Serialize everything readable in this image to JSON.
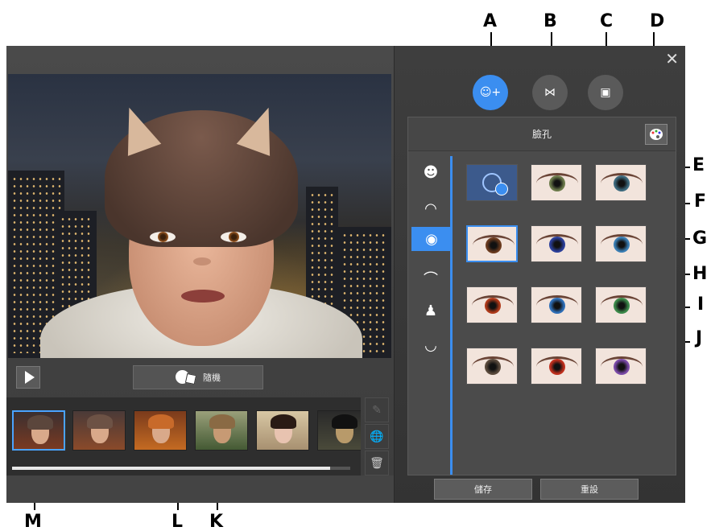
{
  "callouts": [
    "A",
    "B",
    "C",
    "D",
    "E",
    "F",
    "G",
    "H",
    "I",
    "J",
    "K",
    "L",
    "M"
  ],
  "window": {
    "close_glyph": "✕"
  },
  "preview": {
    "background": "night-city-scene"
  },
  "controls": {
    "play_icon": "play-icon",
    "random_label": "隨機"
  },
  "filmstrip": {
    "thumbnails": [
      "thumb-1",
      "thumb-2",
      "thumb-3",
      "thumb-4",
      "thumb-5",
      "thumb-6"
    ],
    "selected_index": 0,
    "scroll_fraction": 0.94
  },
  "side_tools": [
    {
      "icon": "edit-icon"
    },
    {
      "icon": "globe-upload-icon"
    },
    {
      "icon": "trash-icon"
    }
  ],
  "modes": [
    {
      "icon": "face-add-icon",
      "active": true
    },
    {
      "icon": "bow-icon",
      "active": false
    },
    {
      "icon": "image-icon",
      "active": false
    }
  ],
  "panel": {
    "title": "臉孔",
    "palette_icon": "palette-icon",
    "categories": [
      {
        "icon": "face-icon"
      },
      {
        "icon": "hair-icon"
      },
      {
        "icon": "eye-icon",
        "active": true
      },
      {
        "icon": "eyebrow-icon"
      },
      {
        "icon": "nose-icon"
      },
      {
        "icon": "lips-icon"
      }
    ],
    "eye_options": [
      {
        "kind": "download",
        "icon": "globe-download-icon"
      },
      {
        "iris": "#6b7a4a"
      },
      {
        "iris": "#3d6a7e"
      },
      {
        "iris": "#6a3a1e",
        "selected": true
      },
      {
        "iris": "#2b3f9a"
      },
      {
        "iris": "#3a7eb4"
      },
      {
        "iris": "#b03a1a"
      },
      {
        "iris": "#2f6fb8"
      },
      {
        "iris": "#3c8a4a"
      },
      {
        "iris": "#5a4a3c"
      },
      {
        "iris": "#c0301e"
      },
      {
        "iris": "#7a4aa8"
      }
    ]
  },
  "footer": {
    "save_label": "儲存",
    "reset_label": "重設"
  },
  "colors": {
    "accent": "#3b8ef0",
    "panel_bg": "#4b4b4b"
  }
}
